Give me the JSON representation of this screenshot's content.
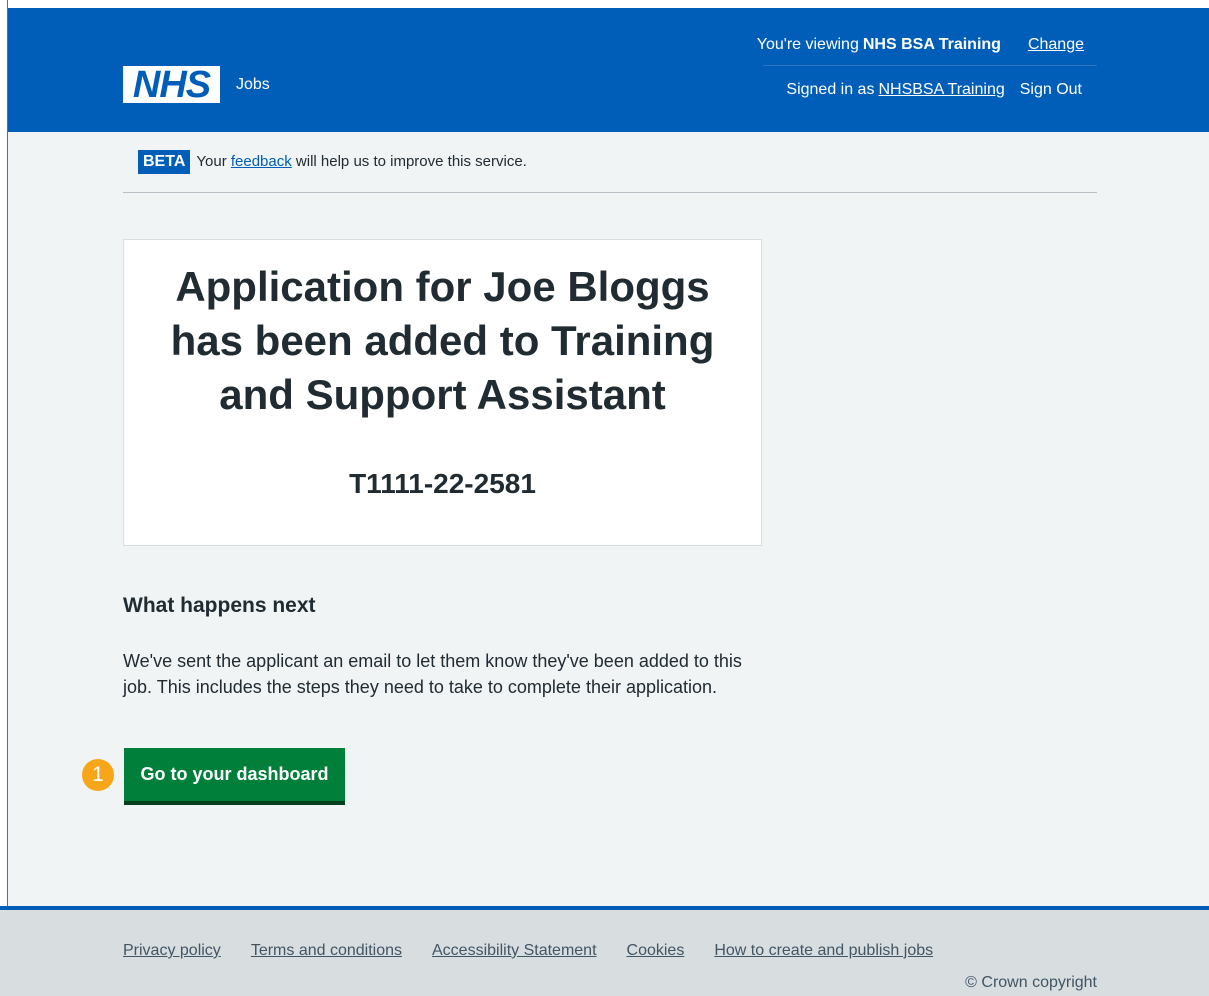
{
  "header": {
    "logo_text": "NHS",
    "service_name": "Jobs",
    "viewing_prefix": "You're viewing",
    "viewing_org": "NHS BSA Training",
    "change_link": "Change",
    "signed_prefix": "Signed in as",
    "signed_user": "NHSBSA Training",
    "sign_out": "Sign Out",
    "brand_color": "#005eb8"
  },
  "beta": {
    "tag": "BETA",
    "before": "Your",
    "link": "feedback",
    "after": "will help us to improve this service."
  },
  "panel": {
    "title": "Application for Joe Bloggs has been added to Training and Support Assistant",
    "reference": "T1111-22-2581"
  },
  "next": {
    "title": "What happens next",
    "body": "We've sent the applicant an email to let them know they've been added to this job. This includes the steps they need to take to complete their application."
  },
  "actions": {
    "dashboard_button": "Go to your dashboard",
    "button_color": "#007f3b",
    "step_marker": "1",
    "marker_color": "#f8a619"
  },
  "footer": {
    "links": [
      "Privacy policy",
      "Terms and conditions",
      "Accessibility Statement",
      "Cookies",
      "How to create and publish jobs"
    ],
    "copyright": "© Crown copyright"
  }
}
